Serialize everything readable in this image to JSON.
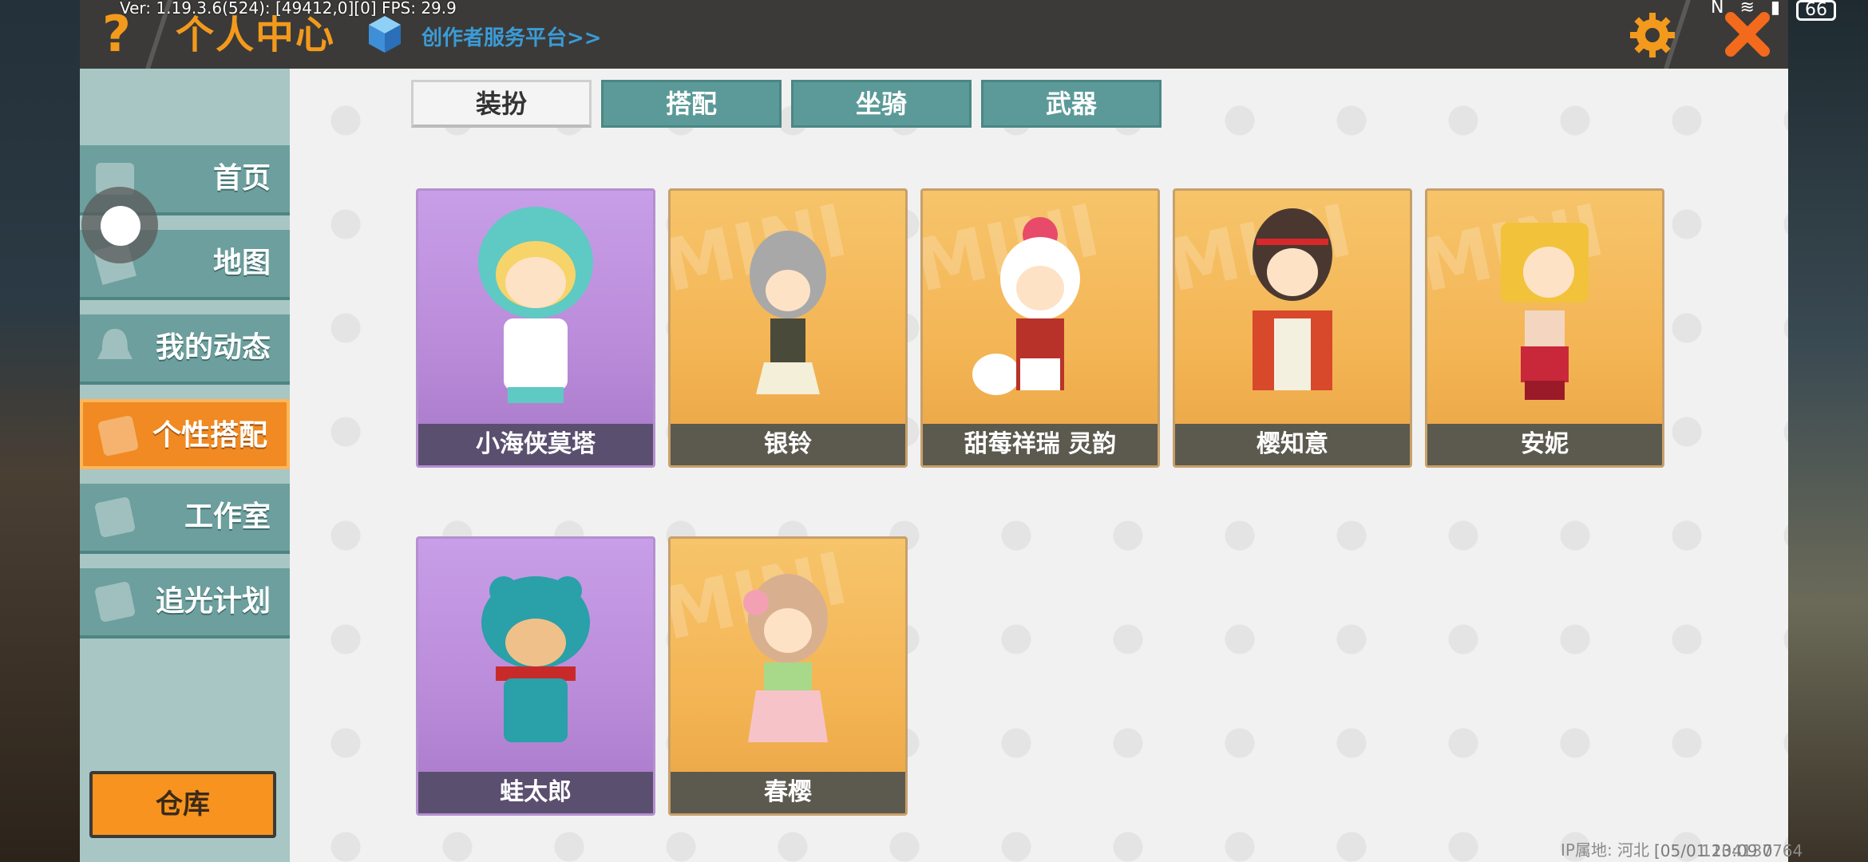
{
  "overlay": {
    "debug": "Ver: 1.19.3.6(524): [49412,0][0] FPS: 29.9",
    "battery": "66"
  },
  "header": {
    "title": "个人中心",
    "creator_link": "创作者服务平台>>"
  },
  "sidebar": {
    "items": [
      {
        "label": "首页",
        "icon": "home-icon"
      },
      {
        "label": "地图",
        "icon": "map-icon"
      },
      {
        "label": "我的动态",
        "icon": "bell-icon"
      },
      {
        "label": "个性搭配",
        "icon": "outfit-icon"
      },
      {
        "label": "工作室",
        "icon": "studio-icon"
      },
      {
        "label": "追光计划",
        "icon": "plan-icon"
      }
    ],
    "active_index": 3,
    "warehouse_label": "仓库"
  },
  "tabs": [
    {
      "label": "装扮",
      "active": true
    },
    {
      "label": "搭配",
      "active": false
    },
    {
      "label": "坐骑",
      "active": false
    },
    {
      "label": "武器",
      "active": false
    }
  ],
  "skins": [
    {
      "name": "小海侠莫塔",
      "bg": "purple"
    },
    {
      "name": "银铃",
      "bg": "orange"
    },
    {
      "name": "甜莓祥瑞 灵韵",
      "bg": "orange"
    },
    {
      "name": "樱知意",
      "bg": "orange"
    },
    {
      "name": "安妮",
      "bg": "orange"
    },
    {
      "name": "蛙太郎",
      "bg": "purple"
    },
    {
      "name": "春樱",
      "bg": "orange"
    }
  ],
  "footer": {
    "ip_location": "IP属地: 河北",
    "user_id": "1104137764",
    "datetime": "[05/01 23:09 0"
  },
  "colors": {
    "accent_orange": "#f39a1c",
    "teal": "#5b9a98",
    "creator_blue": "#3b9bd6"
  }
}
